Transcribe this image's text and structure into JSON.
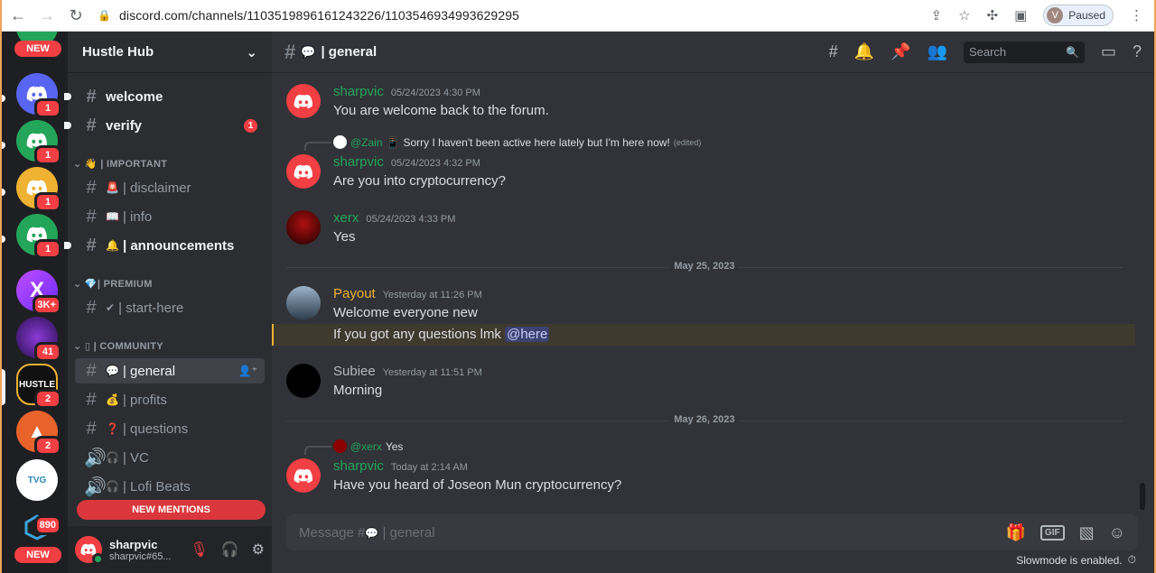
{
  "browser": {
    "url": "discord.com/channels/1103519896161243226/1103546934993629295",
    "profile_initial": "V",
    "profile_status": "Paused"
  },
  "rail": {
    "new_top": "NEW",
    "new_bottom": "NEW",
    "servers": [
      {
        "name": "server-discord-blue",
        "badge": "1",
        "color": "#5865f2"
      },
      {
        "name": "server-discord-green-1",
        "badge": "1",
        "color": "#23a55a"
      },
      {
        "name": "server-discord-yellow",
        "badge": "1",
        "color": "#f0b232"
      },
      {
        "name": "server-discord-green-2",
        "badge": "1",
        "color": "#23a55a"
      },
      {
        "name": "server-x",
        "badge": "3K+",
        "color": "#8e44ff"
      },
      {
        "name": "server-purple",
        "badge": "41",
        "color": "#3b1e6b"
      },
      {
        "name": "server-hustle",
        "badge": "2",
        "label": "HUSTLE",
        "color": "#111111"
      },
      {
        "name": "server-orange-a",
        "badge": "2",
        "color": "#e8632b"
      },
      {
        "name": "server-tvg",
        "badge": "",
        "label": "TVG",
        "color": "#ffffff"
      },
      {
        "name": "server-blue-cube",
        "badge": "890",
        "color": "#1e1f22"
      }
    ]
  },
  "guild": {
    "name": "Hustle Hub",
    "categories": {
      "important": "IMPORTANT",
      "premium": "PREMIUM",
      "community": "COMMUNITY"
    },
    "channels": {
      "welcome": "welcome",
      "verify": "verify",
      "verify_badge": "1",
      "disclaimer": "| disclaimer",
      "info": "| info",
      "announcements": "| announcements",
      "start_here": "| start-here",
      "general": "| general",
      "profits": "| profits",
      "questions": "| questions",
      "vc": "| VC",
      "lofi": "| Lofi Beats"
    },
    "new_mentions": "NEW MENTIONS"
  },
  "user": {
    "name": "sharpvic",
    "tag": "sharpvic#65..."
  },
  "header": {
    "channel": "| general",
    "search_placeholder": "Search"
  },
  "messages": {
    "m1": {
      "author": "sharpvic",
      "time": "05/24/2023 4:30 PM",
      "text": "You are welcome back to the forum."
    },
    "m2_reply": {
      "author": "@Zain",
      "text": "Sorry I haven't been active here lately but I'm here now!",
      "edited": "(edited)"
    },
    "m2": {
      "author": "sharpvic",
      "time": "05/24/2023 4:32 PM",
      "text": "Are you into cryptocurrency?"
    },
    "m3": {
      "author": "xerx",
      "time": "05/24/2023 4:33 PM",
      "text": "Yes"
    },
    "divider1": "May 25, 2023",
    "m4": {
      "author": "Payout",
      "time": "Yesterday at 11:26 PM",
      "text": "Welcome everyone new",
      "text2": "If you got any questions lmk",
      "mention": "@here"
    },
    "m5": {
      "author": "Subiee",
      "time": "Yesterday at 11:51 PM",
      "text": "Morning"
    },
    "divider2": "May 26, 2023",
    "m6_reply": {
      "author": "@xerx",
      "text": "Yes"
    },
    "m6": {
      "author": "sharpvic",
      "time": "Today at 2:14 AM",
      "text": "Have you heard of Joseon Mun cryptocurrency?"
    }
  },
  "composer": {
    "placeholder": "Message #",
    "placeholder_channel": "| general",
    "gif": "GIF",
    "slowmode": "Slowmode is enabled."
  },
  "colors": {
    "sharpvic": "#23a55a",
    "xerx": "#23a55a",
    "payout": "#f0b232",
    "subiee": "#b5bac1"
  }
}
